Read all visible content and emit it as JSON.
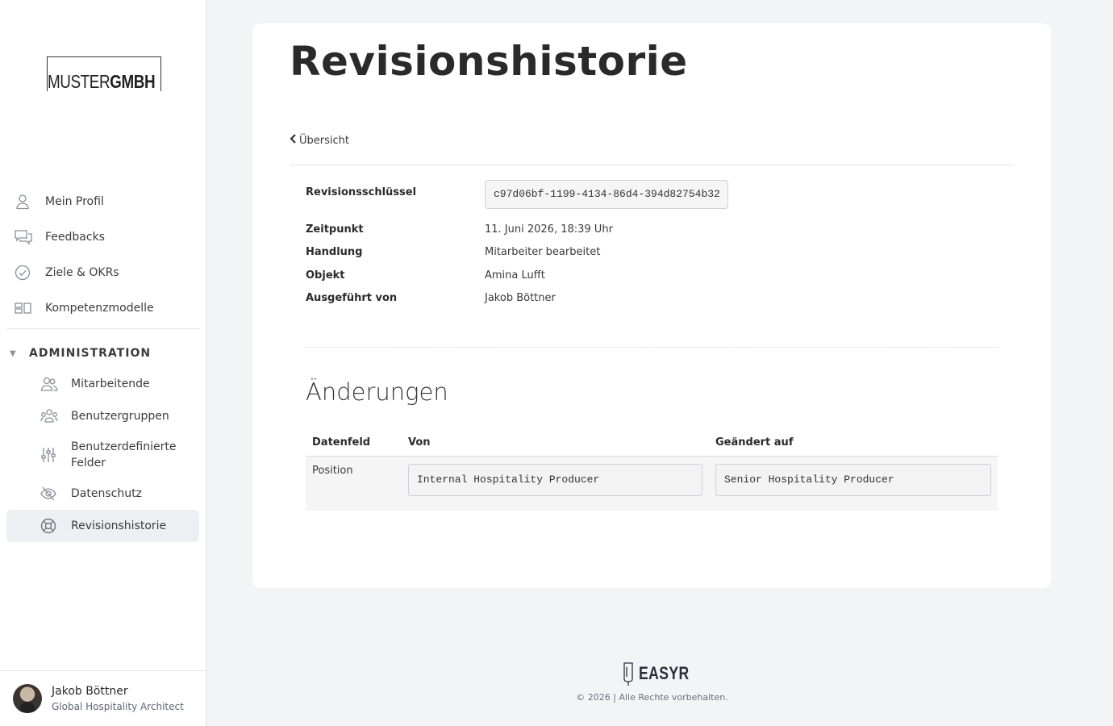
{
  "sidebar": {
    "logo": {
      "light": "MUSTER",
      "bold": "GMBH"
    },
    "nav": [
      {
        "label": "Mein Profil",
        "icon": "user-icon"
      },
      {
        "label": "Feedbacks",
        "icon": "chat-bubbles-icon"
      },
      {
        "label": "Ziele & OKRs",
        "icon": "check-circle-icon"
      },
      {
        "label": "Kompetenzmodelle",
        "icon": "blocks-icon"
      }
    ],
    "admin": {
      "label": "ADMINISTRATION",
      "items": [
        {
          "label": "Mitarbeitende",
          "icon": "users-icon"
        },
        {
          "label": "Benutzergruppen",
          "icon": "user-group-icon"
        },
        {
          "label": "Benutzerdefinierte Felder",
          "icon": "sliders-icon"
        },
        {
          "label": "Datenschutz",
          "icon": "eye-slash-icon"
        },
        {
          "label": "Revisionshistorie",
          "icon": "lifebuoy-icon",
          "active": true
        }
      ]
    },
    "user": {
      "name": "Jakob Böttner",
      "role": "Global Hospitality Architect"
    }
  },
  "main": {
    "title": "Revisionshistorie",
    "back_label": "Übersicht",
    "meta": {
      "key_label": "Revisionsschlüssel",
      "key_value": "c97d06bf-1199-4134-86d4-394d82754b32",
      "time_label": "Zeitpunkt",
      "time_value": "11. Juni 2026, 18:39 Uhr",
      "action_label": "Handlung",
      "action_value": "Mitarbeiter bearbeitet",
      "object_label": "Objekt",
      "object_value": "Amina Lufft",
      "executed_label": "Ausgeführt von",
      "executed_value": "Jakob Böttner"
    },
    "changes": {
      "title": "Änderungen",
      "columns": [
        "Datenfeld",
        "Von",
        "Geändert auf"
      ],
      "rows": [
        {
          "field": "Position",
          "from": "Internal Hospitality Producer",
          "to": "Senior Hospitality Producer"
        }
      ]
    }
  },
  "footer": {
    "brand": "EASYR",
    "copyright": "© 2026 | Alle Rechte vorbehalten."
  },
  "colors": {
    "background": "#f3f4f6",
    "card": "#ffffff",
    "active_nav": "#eeeff2",
    "icon": "#8a8f99"
  }
}
